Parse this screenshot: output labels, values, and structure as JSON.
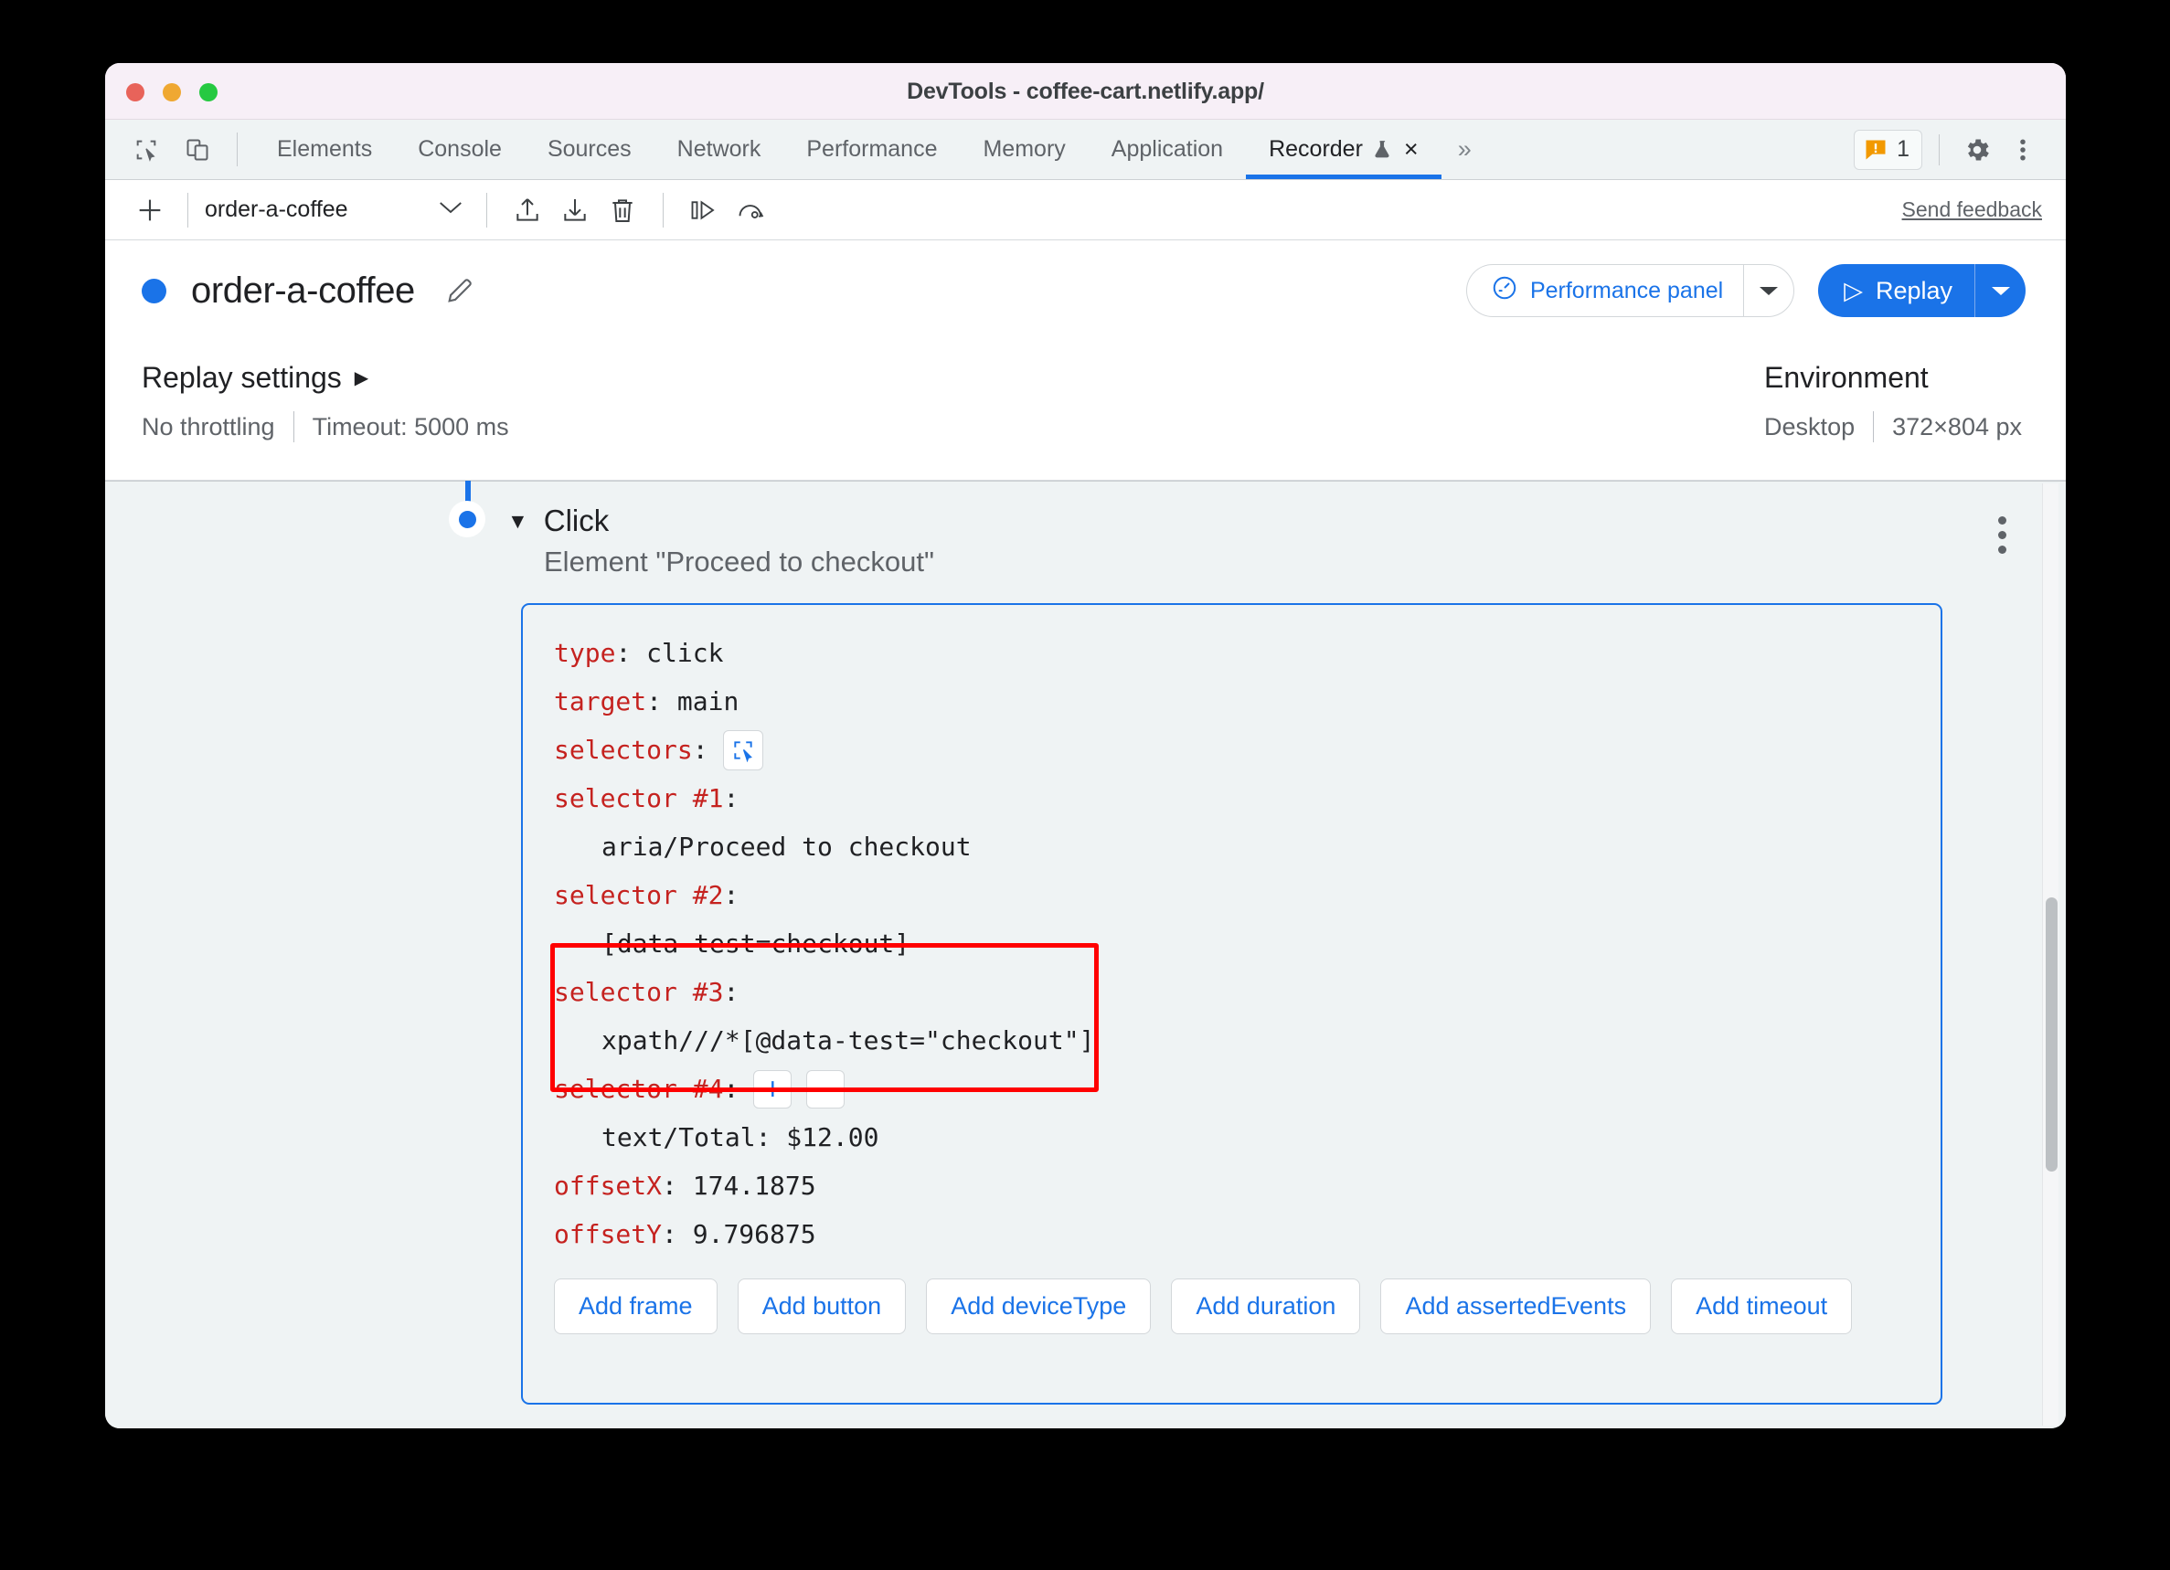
{
  "window": {
    "title": "DevTools - coffee-cart.netlify.app/",
    "traffic_lights": [
      "close-red",
      "minimize-yellow",
      "maximize-green"
    ]
  },
  "tabstrip": {
    "left_icons": [
      {
        "name": "inspect-element-icon"
      },
      {
        "name": "device-toolbar-icon"
      }
    ],
    "tabs": [
      {
        "label": "Elements",
        "active": false
      },
      {
        "label": "Console",
        "active": false
      },
      {
        "label": "Sources",
        "active": false
      },
      {
        "label": "Network",
        "active": false
      },
      {
        "label": "Performance",
        "active": false
      },
      {
        "label": "Memory",
        "active": false
      },
      {
        "label": "Application",
        "active": false
      },
      {
        "label": "Recorder",
        "active": true,
        "experimental": true,
        "closable": true
      }
    ],
    "overflow_label": "»",
    "close_glyph": "×",
    "warning_count": "1",
    "right_icons": [
      {
        "name": "gear-icon"
      },
      {
        "name": "kebab-menu-icon"
      }
    ]
  },
  "recorder_toolbar": {
    "add_recording_label": "+",
    "selected_recording": "order-a-coffee",
    "dropdown_caret": "∨",
    "icons": [
      {
        "name": "export-icon"
      },
      {
        "name": "import-icon"
      },
      {
        "name": "delete-icon"
      },
      {
        "name": "step-over-icon"
      },
      {
        "name": "replay-speed-icon"
      }
    ],
    "send_feedback": "Send feedback"
  },
  "recording_header": {
    "status_dot_color": "#1a73e8",
    "name": "order-a-coffee",
    "edit_icon": "pencil-icon",
    "performance_button": "Performance panel",
    "performance_caret": "▾",
    "replay_button": "Replay",
    "replay_play_glyph": "▷",
    "replay_caret": "▾"
  },
  "settings": {
    "replay_title": "Replay settings",
    "replay_expand_glyph": "▶",
    "throttling": "No throttling",
    "timeout": "Timeout: 5000 ms",
    "environment_title": "Environment",
    "device": "Desktop",
    "viewport": "372×804 px"
  },
  "step": {
    "caret": "▼",
    "title": "Click",
    "subtitle": "Element \"Proceed to checkout\"",
    "kebab": "step-menu-icon",
    "code": {
      "type_key": "type",
      "type_value": ": click",
      "target_key": "target",
      "target_value": ": main",
      "selectors_key": "selectors",
      "selectors_value": ":",
      "picker_icon": "select-element-icon",
      "selectors": [
        {
          "key": "selector #1",
          "colon": ":",
          "value": "aria/Proceed to checkout"
        },
        {
          "key": "selector #2",
          "colon": ":",
          "value": "[data-test=checkout]"
        },
        {
          "key": "selector #3",
          "colon": ":",
          "value": "xpath///*[@data-test=\"checkout\"]"
        },
        {
          "key": "selector #4",
          "colon": ":",
          "value": "text/Total: $12.00",
          "add_glyph": "+",
          "remove_glyph": "−"
        }
      ],
      "offsetx_key": "offsetX",
      "offsetx_value": ": 174.1875",
      "offsety_key": "offsetY",
      "offsety_value": ": 9.796875"
    },
    "add_buttons": [
      "Add frame",
      "Add button",
      "Add deviceType",
      "Add duration",
      "Add assertedEvents",
      "Add timeout"
    ]
  },
  "colors": {
    "accent_blue": "#1a73e8",
    "code_key_red": "#c5221f",
    "highlight_red": "#ff0000",
    "warning_orange": "#f29900"
  }
}
